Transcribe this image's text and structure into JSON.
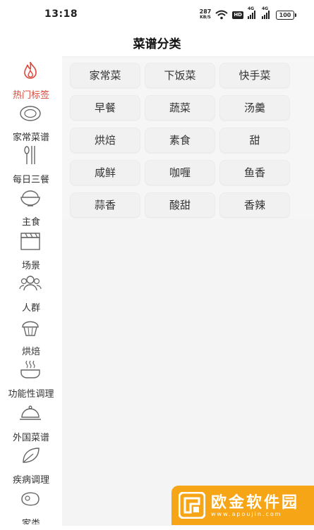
{
  "status": {
    "time": "13:18",
    "net_speed": "287",
    "net_unit": "KB/S",
    "hd": "HD",
    "sig1": "4G",
    "sig2": "4G",
    "battery": "100"
  },
  "header": {
    "title": "菜谱分类"
  },
  "sidebar": {
    "items": [
      {
        "label": "热门标签",
        "icon": "fire-icon",
        "active": true
      },
      {
        "label": "家常菜谱",
        "icon": "plate-icon"
      },
      {
        "label": "每日三餐",
        "icon": "utensils-icon"
      },
      {
        "label": "主食",
        "icon": "rice-bowl-icon"
      },
      {
        "label": "场景",
        "icon": "clapperboard-icon"
      },
      {
        "label": "人群",
        "icon": "people-icon"
      },
      {
        "label": "烘焙",
        "icon": "muffin-icon"
      },
      {
        "label": "功能性调理",
        "icon": "steaming-pot-icon"
      },
      {
        "label": "外国菜谱",
        "icon": "cloche-icon"
      },
      {
        "label": "疾病调理",
        "icon": "leaf-icon"
      },
      {
        "label": "家类",
        "icon": "meat-icon"
      }
    ]
  },
  "tags": [
    "家常菜",
    "下饭菜",
    "快手菜",
    "早餐",
    "蔬菜",
    "汤羹",
    "烘焙",
    "素食",
    "甜",
    "咸鲜",
    "咖喱",
    "鱼香",
    "蒜香",
    "酸甜",
    "香辣"
  ],
  "watermark": {
    "text": "欧金软件园",
    "url": "www.apoujin.com"
  },
  "colors": {
    "accent": "#d9483b",
    "watermark": "#f6a516"
  }
}
